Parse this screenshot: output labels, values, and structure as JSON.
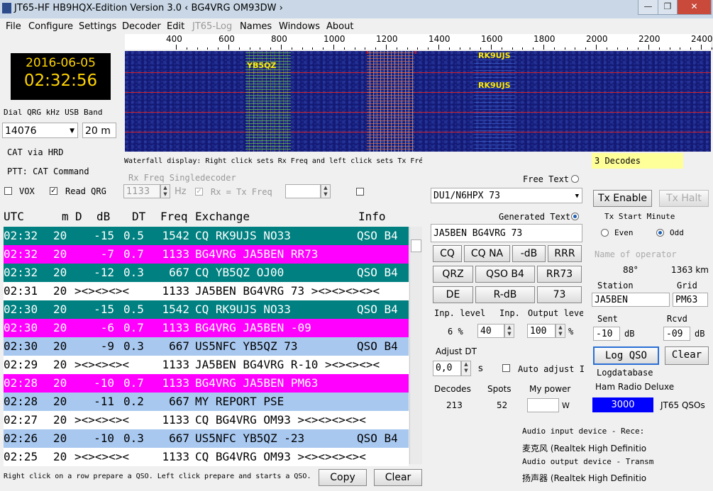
{
  "window": {
    "title": "JT65-HF HB9HQX-Edition Version 3.0  ‹ BG4VRG OM93DW ›",
    "buttons": [
      "minimize",
      "restore",
      "close"
    ]
  },
  "menu": [
    "File",
    "Configure",
    "Settings",
    "Decoder",
    "Edit",
    "JT65-Log",
    "Names",
    "Windows",
    "About"
  ],
  "clock": {
    "date": "2016-06-05",
    "time": "02:32:56"
  },
  "dial": {
    "label": "Dial QRG kHz USB",
    "value": "14076",
    "band_label": "Band",
    "band": "20 m"
  },
  "cat_label": "CAT via HRD",
  "ptt_label": "PTT: CAT Command",
  "vox": {
    "label": "VOX",
    "checked": false
  },
  "read_qrg": {
    "label": "Read QRG",
    "checked": true
  },
  "ruler": {
    "ticks": [
      "400",
      "600",
      "800",
      "1000",
      "1200",
      "1400",
      "1600",
      "1800",
      "2000",
      "2200",
      "2400"
    ]
  },
  "waterfall": {
    "labels": [
      "YB5QZ",
      "RK9UJS",
      "RK9UJS"
    ],
    "hint": "Waterfall display: Right click sets Rx Freq and left click sets Tx Fré"
  },
  "rx": {
    "label": "Rx Freq Singledecoder",
    "value": "1133",
    "unit": "Hz",
    "rx_eq_tx": "Rx = Tx Freq"
  },
  "tx": {
    "enable": "Tx Enable",
    "halt": "Tx Halt",
    "start_minute": "Tx Start Minute",
    "even": "Even",
    "odd": "Odd"
  },
  "table": {
    "headers": {
      "utc": "UTC",
      "m": "m",
      "d": "D",
      "db": "dB",
      "dt": "DT",
      "freq": "Freq",
      "exchange": "Exchange",
      "info": "Info"
    },
    "rows": [
      {
        "style": "teal",
        "utc": "02:32",
        "m": "20",
        "db": "-15",
        "dt": "0.5",
        "freq": "1542",
        "ex": "CQ RK9UJS NO33",
        "info": "QSO B4"
      },
      {
        "style": "mag",
        "utc": "02:32",
        "m": "20",
        "db": "-7",
        "dt": "0.7",
        "freq": "1133",
        "ex": "BG4VRG JA5BEN RR73",
        "info": ""
      },
      {
        "style": "teal",
        "utc": "02:32",
        "m": "20",
        "db": "-12",
        "dt": "0.3",
        "freq": "667",
        "ex": "CQ YB5QZ OJ00",
        "info": "QSO B4"
      },
      {
        "style": "white",
        "utc": "02:31",
        "m": "20",
        "db": "><><><><",
        "dt": "",
        "freq": "1133",
        "ex": "JA5BEN BG4VRG 73 ><><><><><",
        "info": ""
      },
      {
        "style": "teal",
        "utc": "02:30",
        "m": "20",
        "db": "-15",
        "dt": "0.5",
        "freq": "1542",
        "ex": "CQ RK9UJS NO33",
        "info": "QSO B4"
      },
      {
        "style": "mag",
        "utc": "02:30",
        "m": "20",
        "db": "-6",
        "dt": "0.7",
        "freq": "1133",
        "ex": "BG4VRG JA5BEN -09",
        "info": ""
      },
      {
        "style": "blue",
        "utc": "02:30",
        "m": "20",
        "db": "-9",
        "dt": "0.3",
        "freq": "667",
        "ex": "US5NFC YB5QZ 73",
        "info": "QSO B4"
      },
      {
        "style": "white",
        "utc": "02:29",
        "m": "20",
        "db": "><><><><",
        "dt": "",
        "freq": "1133",
        "ex": "JA5BEN BG4VRG R-10 ><><><><",
        "info": ""
      },
      {
        "style": "mag",
        "utc": "02:28",
        "m": "20",
        "db": "-10",
        "dt": "0.7",
        "freq": "1133",
        "ex": "BG4VRG JA5BEN PM63",
        "info": ""
      },
      {
        "style": "blue",
        "utc": "02:28",
        "m": "20",
        "db": "-11",
        "dt": "0.2",
        "freq": "667",
        "ex": "MY REPORT PSE",
        "info": ""
      },
      {
        "style": "white",
        "utc": "02:27",
        "m": "20",
        "db": "><><><><",
        "dt": "",
        "freq": "1133",
        "ex": "CQ BG4VRG OM93 ><><><><><",
        "info": ""
      },
      {
        "style": "blue",
        "utc": "02:26",
        "m": "20",
        "db": "-10",
        "dt": "0.3",
        "freq": "667",
        "ex": "US5NFC YB5QZ -23",
        "info": "QSO B4"
      },
      {
        "style": "white",
        "utc": "02:25",
        "m": "20",
        "db": "><><><><",
        "dt": "",
        "freq": "1133",
        "ex": "CQ BG4VRG OM93 ><><><><><",
        "info": ""
      }
    ]
  },
  "footer": {
    "hint": "Right click on a row prepare a QSO. Left click prepare and starts a QSO.",
    "copy": "Copy",
    "clear": "Clear"
  },
  "free_text": {
    "label": "Free Text",
    "value": "DU1/N6HPX 73"
  },
  "generated_text": {
    "label": "Generated Text",
    "value": "JA5BEN BG4VRG 73"
  },
  "msg_buttons": [
    [
      "CQ",
      "CQ NA",
      "-dB",
      "RRR"
    ],
    [
      "QRZ",
      "QSO B4",
      "RR73"
    ],
    [
      "DE",
      "R-dB",
      "73"
    ]
  ],
  "levels": {
    "inp_level_label": "Inp. level",
    "inp_label": "Inp.",
    "out_label": "Output leve",
    "inp_level": "6 %",
    "inp": "40",
    "out": "100",
    "out_unit": "%"
  },
  "adjust_dt": {
    "label": "Adjust DT",
    "value": "0,0",
    "unit": "s",
    "auto": "Auto adjust I"
  },
  "stats": {
    "decodes_label": "Decodes",
    "decodes": "213",
    "spots_label": "Spots",
    "spots": "52",
    "power_label": "My power",
    "power_unit": "W"
  },
  "decodes_count": "3 Decodes",
  "operator": {
    "name_placeholder": "Name of operator",
    "bearing": "88°",
    "distance": "1363 km",
    "station_label": "Station",
    "station": "JA5BEN",
    "grid_label": "Grid",
    "grid": "PM63"
  },
  "report": {
    "sent_label": "Sent",
    "sent": "-10",
    "rcvd_label": "Rcvd",
    "rcvd": "-09",
    "unit": "dB"
  },
  "log": {
    "log_qso": "Log QSO",
    "clear": "Clear",
    "db_label": "Logdatabase",
    "db": "Ham Radio Deluxe",
    "qso_count": "3000",
    "qso_label": "JT65 QSOs"
  },
  "audio": {
    "input_label": "Audio input device - Rece:",
    "input": "麦克风 (Realtek High Definitio",
    "output_label": "Audio output device - Transm",
    "output": "扬声器 (Realtek High Definitio"
  },
  "colors": {
    "teal": "#008080",
    "magenta": "#ff00ff",
    "blue": "#a8c8f0",
    "waterfall": "#141a74"
  }
}
